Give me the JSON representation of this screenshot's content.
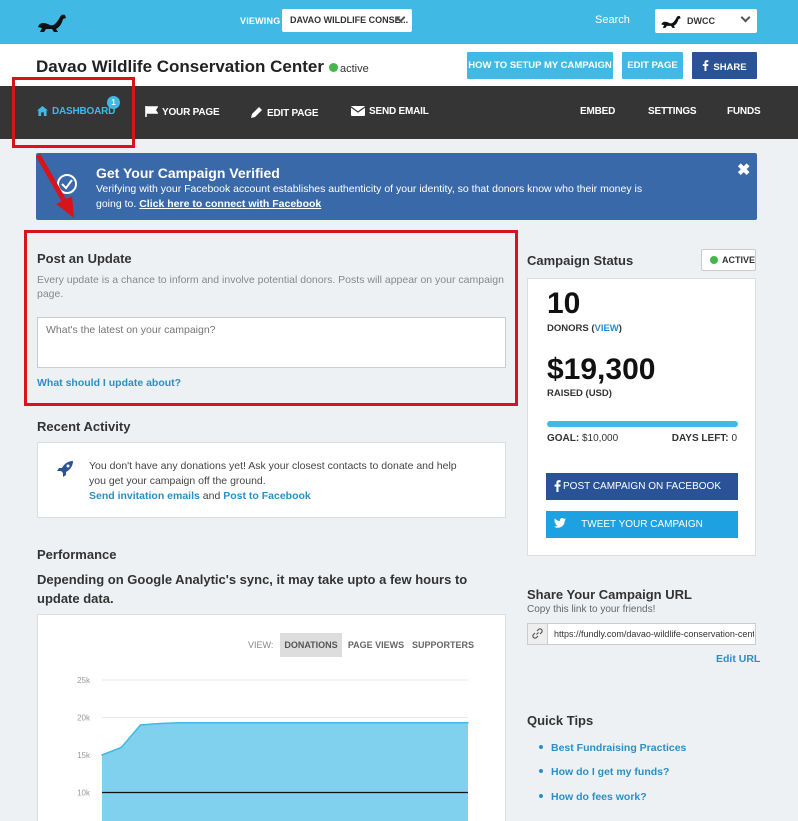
{
  "topbar": {
    "viewing_label": "VIEWING",
    "viewing_value": "DAVAO WILDLIFE CONSE...",
    "search_label": "Search",
    "org_value": "DWCC"
  },
  "header": {
    "title": "Davao Wildlife Conservation Center",
    "status": "active",
    "btn_setup": "HOW TO SETUP MY CAMPAIGN",
    "btn_edit": "EDIT PAGE",
    "btn_share": "SHARE"
  },
  "nav": {
    "dashboard": "DASHBOARD",
    "dashboard_badge": "1",
    "your_page": "YOUR PAGE",
    "edit_page": "EDIT PAGE",
    "send_email": "SEND EMAIL",
    "embed": "EMBED",
    "settings": "SETTINGS",
    "funds": "FUNDS"
  },
  "banner": {
    "title": "Get Your Campaign Verified",
    "text": "Verifying with your Facebook account establishes authenticity of your identity, so that donors know who their money is going to.",
    "link": "Click here to connect with Facebook",
    "close": "✖"
  },
  "post": {
    "title": "Post an Update",
    "desc": "Every update is a chance to inform and involve potential donors. Posts will appear on your campaign page.",
    "placeholder": "What's the latest on your campaign?",
    "link": "What should I update about?"
  },
  "recent": {
    "title": "Recent Activity",
    "text": "You don't have any donations yet! Ask your closest contacts to donate and help you get your campaign off the ground.",
    "link1": "Send invitation emails",
    "and": "and",
    "link2": "Post to Facebook"
  },
  "performance": {
    "title": "Performance",
    "subtitle": "Depending on Google Analytic's sync, it may take upto a few hours to update data.",
    "view_label": "VIEW:",
    "tabs": [
      "DONATIONS",
      "PAGE VIEWS",
      "SUPPORTERS"
    ]
  },
  "chart_data": {
    "type": "area",
    "title": "",
    "xlabel": "",
    "ylabel": "",
    "ytick_labels": [
      "25k",
      "20k",
      "15k",
      "10k"
    ],
    "ylim": [
      0,
      25000
    ],
    "series": [
      {
        "values": [
          15000,
          16000,
          19000,
          19200,
          19300,
          19300,
          19300,
          19300,
          19300,
          19300,
          19300,
          19300,
          19300,
          19300,
          19300,
          19300,
          19300,
          19300,
          19300,
          19300
        ]
      }
    ],
    "goal_line": 10000,
    "fill_color": "#7fd1ee",
    "line_color": "#40b9e4"
  },
  "campaign": {
    "title": "Campaign Status",
    "status_badge": "ACTIVE",
    "donors": "10",
    "donors_label": "DONORS (",
    "donors_link": "VIEW",
    "donors_close": ")",
    "raised": "$19,300",
    "raised_label": "RAISED (USD)",
    "progress_fraction": 1.0,
    "goal_label": "GOAL:",
    "goal_value": "$10,000",
    "days_label": "DAYS LEFT:",
    "days_value": "0",
    "btn_facebook": "POST CAMPAIGN ON FACEBOOK",
    "btn_twitter": "TWEET YOUR CAMPAIGN"
  },
  "share": {
    "title": "Share Your Campaign URL",
    "sub": "Copy this link to your friends!",
    "url": "https://fundly.com/davao-wildlife-conservation-center",
    "edit": "Edit URL"
  },
  "tips": {
    "title": "Quick Tips",
    "items": [
      "Best Fundraising Practices",
      "How do I get my funds?",
      "How do fees work?"
    ]
  },
  "colors": {
    "topbar": "#40b9e4",
    "nav": "#353535",
    "banner": "#3a69aa",
    "highlight": "#d8141a",
    "link": "#2b8fc5",
    "facebook": "#2a5397",
    "twitter": "#1da1e1"
  }
}
